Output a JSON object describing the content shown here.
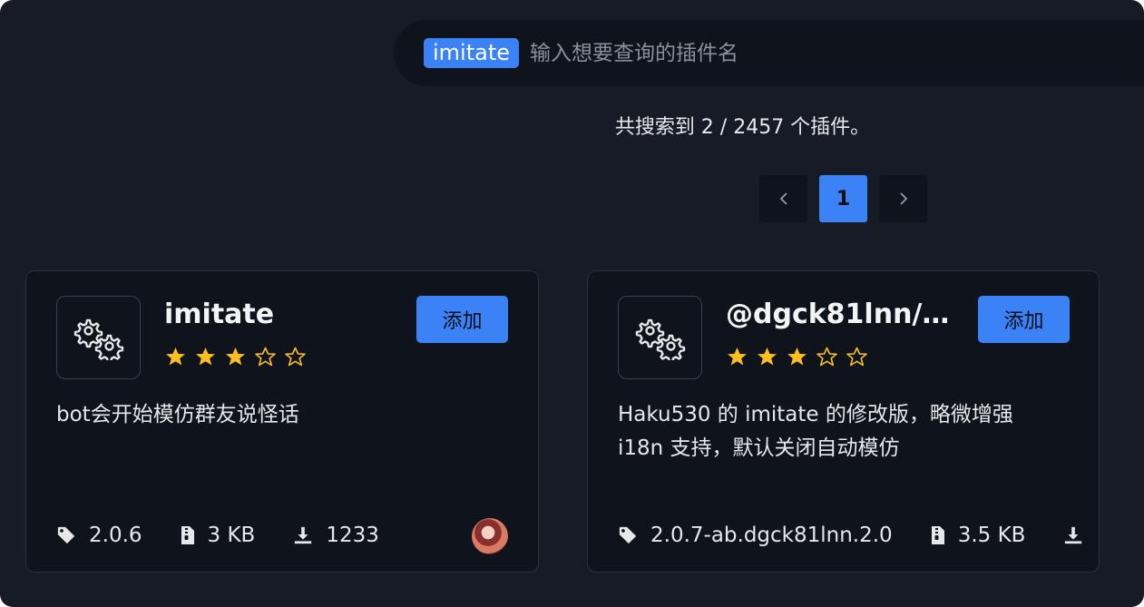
{
  "search": {
    "tag": "imitate",
    "placeholder": "输入想要查询的插件名"
  },
  "results": {
    "summary": "共搜索到 2 / 2457 个插件。"
  },
  "pager": {
    "prev_icon": "chevron-left-icon",
    "current": "1",
    "next_icon": "chevron-right-icon"
  },
  "plugins": [
    {
      "name": "imitate",
      "rating": 3,
      "rating_max": 5,
      "add_label": "添加",
      "description": "bot会开始模仿群友说怪话",
      "version": "2.0.6",
      "size": "3 KB",
      "downloads": "1233",
      "has_avatar": true
    },
    {
      "name": "@dgck81lnn/i...",
      "rating": 3,
      "rating_max": 5,
      "add_label": "添加",
      "description": "Haku530 的 imitate 的修改版，略微增强 i18n 支持，默认关闭自动模仿",
      "version": "2.0.7-ab.dgck81lnn.2.0",
      "size": "3.5 KB",
      "downloads": ""
    }
  ],
  "colors": {
    "background": "#161b25",
    "card": "#0f131b",
    "accent": "#3b82f6",
    "star": "#fbbf24"
  }
}
